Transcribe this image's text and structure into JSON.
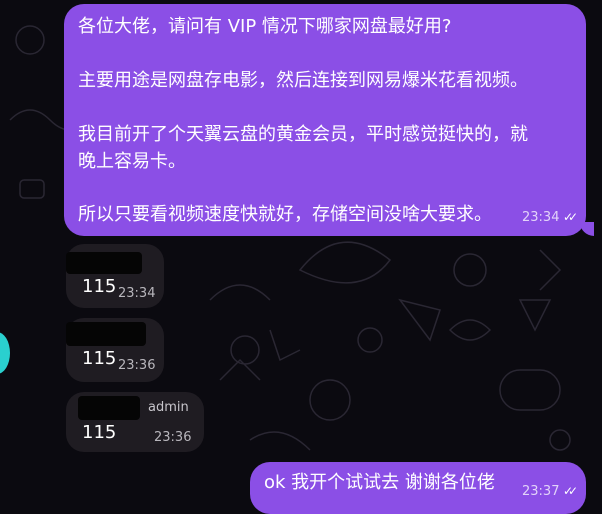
{
  "chat": {
    "outgoing_1": {
      "lines": [
        "各位大佬，请问有 VIP 情况下哪家网盘最好用?",
        "",
        "主要用途是网盘存电影，然后连接到网易爆米花看视频。",
        "",
        "我目前开了个天翼云盘的黄金会员，平时感觉挺快的，就",
        "晚上容易卡。",
        "",
        "所以只要看视频速度快就好，存储空间没啥大要求。"
      ],
      "time": "23:34",
      "status": "read-double-check"
    },
    "incoming": [
      {
        "text": "115",
        "time": "23:34",
        "sender": ""
      },
      {
        "text": "115",
        "time": "23:36",
        "sender": ""
      },
      {
        "text": "115",
        "time": "23:36",
        "sender": "admin"
      }
    ],
    "outgoing_2": {
      "text": "ok 我开个试试去  谢谢各位佬",
      "time": "23:37",
      "status": "read-double-check"
    }
  },
  "colors": {
    "outgoing_bubble": "#8b4fe6",
    "incoming_bubble": "#1f1c22",
    "background": "#0b0a10",
    "avatar_accent": "#2ad0cf"
  }
}
